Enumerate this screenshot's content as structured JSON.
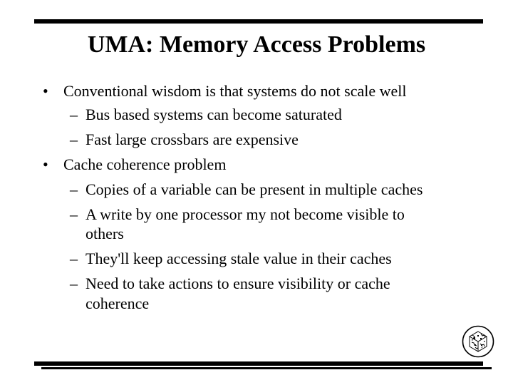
{
  "slide": {
    "title": "UMA: Memory Access Problems",
    "bullet_glyph": "•",
    "dash_glyph": "–",
    "items": [
      {
        "level": 1,
        "text": "Conventional wisdom is that systems do not scale well"
      },
      {
        "level": 2,
        "text": "Bus based systems can become saturated"
      },
      {
        "level": 2,
        "text": "Fast large crossbars are expensive"
      },
      {
        "level": 1,
        "text": "Cache coherence problem"
      },
      {
        "level": 2,
        "text": "Copies of a variable can be present in multiple caches"
      },
      {
        "level": 2,
        "text": "A write by one processor my not become visible to",
        "continuation": "others"
      },
      {
        "level": 2,
        "text": "They'll keep accessing stale value in their caches"
      },
      {
        "level": 2,
        "text": "Need to take actions to ensure visibility or cache",
        "continuation": "coherence"
      }
    ],
    "logo": {
      "icon": "university-seal-icon"
    }
  }
}
